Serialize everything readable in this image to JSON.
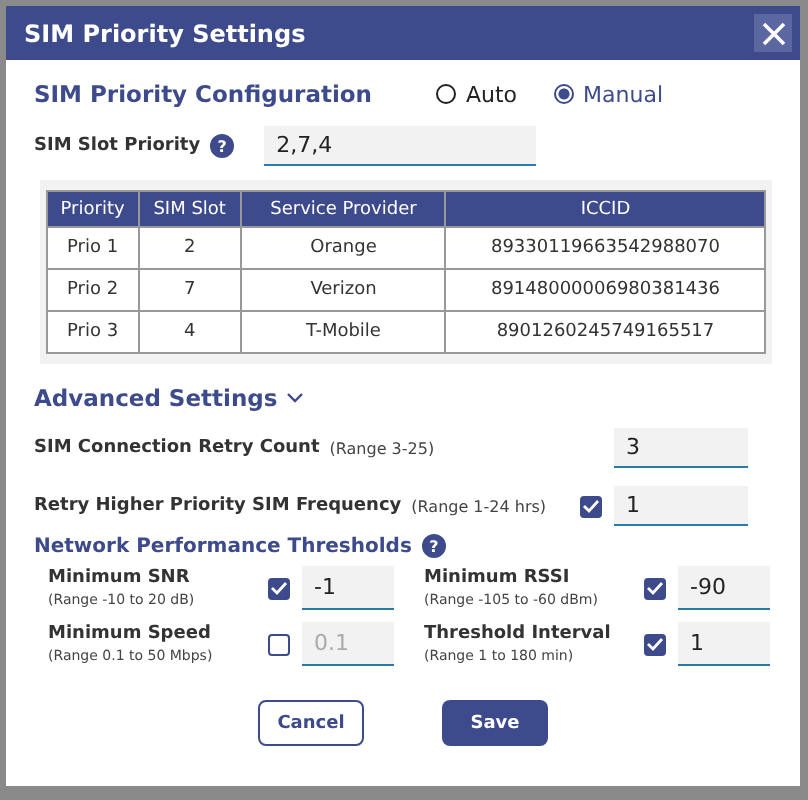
{
  "window": {
    "title": "SIM Priority Settings"
  },
  "config": {
    "title": "SIM Priority Configuration",
    "options": [
      {
        "label": "Auto",
        "selected": false
      },
      {
        "label": "Manual",
        "selected": true
      }
    ]
  },
  "slot_priority": {
    "label": "SIM Slot Priority",
    "help": "?",
    "value": "2,7,4"
  },
  "table": {
    "columns": [
      "Priority",
      "SIM Slot",
      "Service Provider",
      "ICCID"
    ],
    "rows": [
      [
        "Prio 1",
        "2",
        "Orange",
        "89330119663542988070"
      ],
      [
        "Prio 2",
        "7",
        "Verizon",
        "89148000006980381436"
      ],
      [
        "Prio 3",
        "4",
        "T-Mobile",
        "8901260245749165517"
      ]
    ]
  },
  "advanced": {
    "title": "Advanced Settings",
    "expanded": true
  },
  "retry_count": {
    "label": "SIM Connection Retry Count",
    "range": "(Range 3-25)",
    "value": "3"
  },
  "retry_frequency": {
    "label": "Retry Higher Priority SIM Frequency",
    "range": "(Range 1-24 hrs)",
    "checked": true,
    "value": "1"
  },
  "thresholds": {
    "title": "Network Performance Thresholds",
    "help": "?",
    "items": [
      {
        "label": "Minimum SNR",
        "range": "(Range -10 to 20 dB)",
        "checked": true,
        "value": "-1"
      },
      {
        "label": "Minimum RSSI",
        "range": "(Range -105 to -60 dBm)",
        "checked": true,
        "value": "-90"
      },
      {
        "label": "Minimum Speed",
        "range": "(Range 0.1 to 50 Mbps)",
        "checked": false,
        "value": "0.1"
      },
      {
        "label": "Threshold Interval",
        "range": "(Range 1 to 180 min)",
        "checked": true,
        "value": "1"
      }
    ]
  },
  "buttons": {
    "cancel": "Cancel",
    "save": "Save"
  }
}
